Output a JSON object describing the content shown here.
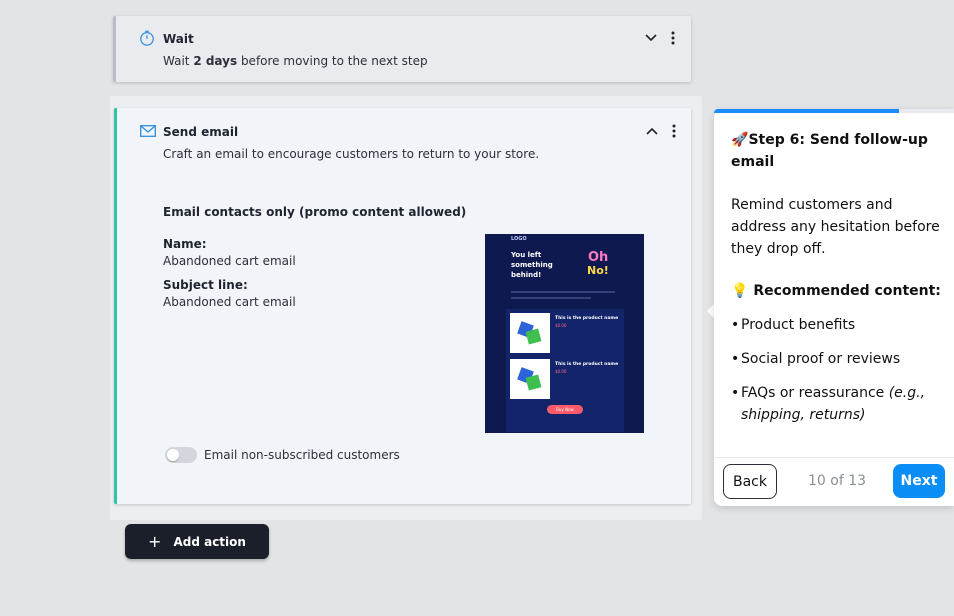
{
  "wait_step": {
    "title": "Wait",
    "desc_prefix": "Wait ",
    "desc_bold": "2 days",
    "desc_suffix": " before moving to the next step"
  },
  "email_step": {
    "title": "Send email",
    "description": "Craft an email to encourage customers to return to your store.",
    "mode": "Email contacts only (promo content allowed)",
    "name_label": "Name:",
    "name_value": "Abandoned cart email",
    "subject_label": "Subject line:",
    "subject_value": "Abandoned cart email",
    "toggle_label": "Email non-subscribed customers",
    "toggle_on": false,
    "preview": {
      "logo": "LOGO",
      "headline_1": "You left",
      "headline_2": "something",
      "headline_3": "behind!",
      "badge_1": "Oh",
      "badge_2": "No!",
      "product_1": "This is the product name",
      "product_1_price": "$0.00",
      "product_2": "This is the product name",
      "product_2_price": "$0.00",
      "cta": "Buy Now"
    }
  },
  "add_action": {
    "label": "Add action"
  },
  "tour": {
    "step_emoji": "🚀",
    "step_title": "Step 6: Send follow-up email",
    "body": "Remind customers and address any hesitation before they drop off.",
    "rec_emoji": "💡",
    "rec_title": "Recommended content:",
    "items": [
      {
        "text": "Product benefits",
        "italic": ""
      },
      {
        "text": "Social proof or reviews",
        "italic": ""
      },
      {
        "text": "FAQs or reassurance ",
        "italic": "(e.g., shipping, returns)"
      }
    ],
    "back_label": "Back",
    "next_label": "Next",
    "step_count": "10 of 13",
    "progress": 0.77
  },
  "colors": {
    "accent": "#2ec4a4",
    "primary_blue": "#0a8ef5",
    "dark_button": "#1b1f2a"
  }
}
